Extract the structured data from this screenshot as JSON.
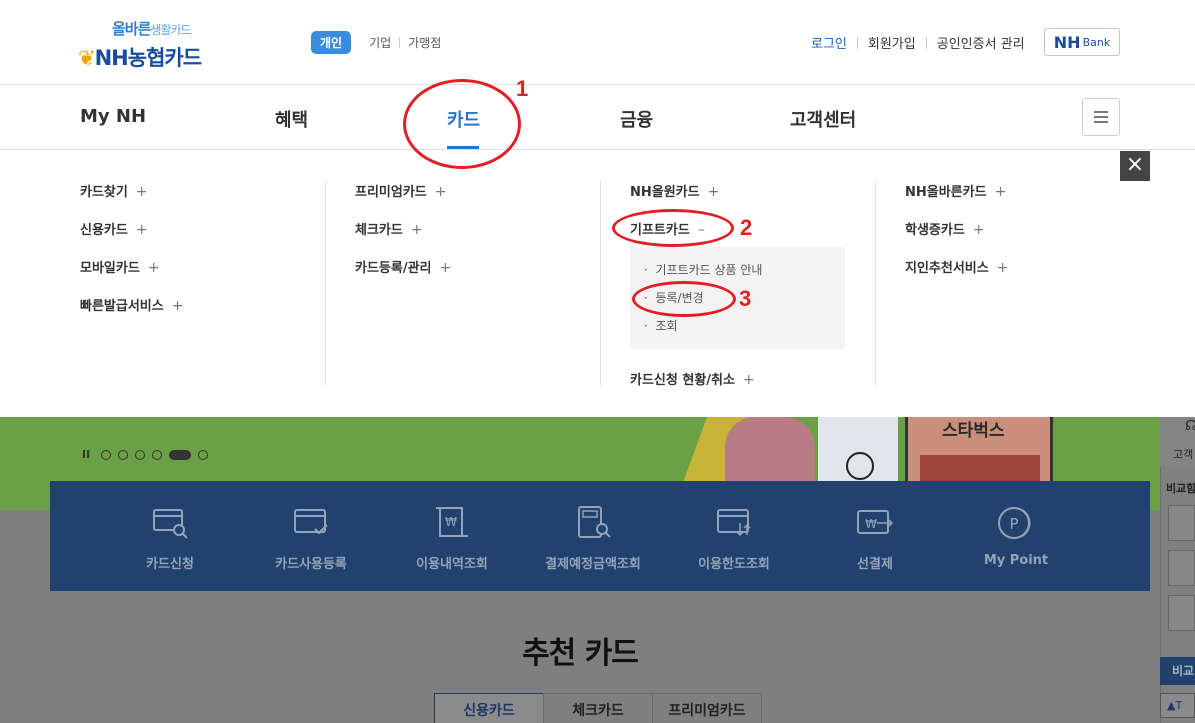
{
  "header": {
    "logo_top": "올바른",
    "logo_top_sub": "생활카드",
    "logo_main": "NH농협카드",
    "segments": [
      "개인",
      "기업",
      "가맹점"
    ],
    "util_links": [
      "로그인",
      "회원가입",
      "공인인증서 관리"
    ],
    "nhbank_main": "NH",
    "nhbank_sub": "Bank"
  },
  "gnb": {
    "items": [
      "My NH",
      "혜택",
      "카드",
      "금융",
      "고객센터"
    ],
    "active": "카드"
  },
  "mega": {
    "col1": [
      "카드찾기",
      "신용카드",
      "모바일카드",
      "빠른발급서비스"
    ],
    "col2": [
      "프리미엄카드",
      "체크카드",
      "카드등록/관리"
    ],
    "col3": [
      "NH올원카드",
      "기프트카드",
      "카드신청 현황/취소"
    ],
    "col3_sub": [
      "기프트카드 상품 안내",
      "등록/변경",
      "조회"
    ],
    "col4": [
      "NH올바른카드",
      "학생증카드",
      "지인추천서비스"
    ],
    "plus": "+",
    "minus": "–",
    "close": "×"
  },
  "annotations": [
    "1",
    "2",
    "3"
  ],
  "banner": {
    "brand": "스타벅스",
    "pause": "II"
  },
  "quick_menu": [
    "카드신청",
    "카드사용등록",
    "이용내역조회",
    "결제예정금액조회",
    "이용한도조회",
    "선결제",
    "My Point"
  ],
  "recommend": {
    "title": "추천 카드",
    "tabs": [
      "신용카드",
      "체크카드",
      "프리미엄카드"
    ]
  },
  "side": {
    "label_top": "고객",
    "label_compare": "비교함",
    "btn": "비교",
    "top": "▲T"
  }
}
